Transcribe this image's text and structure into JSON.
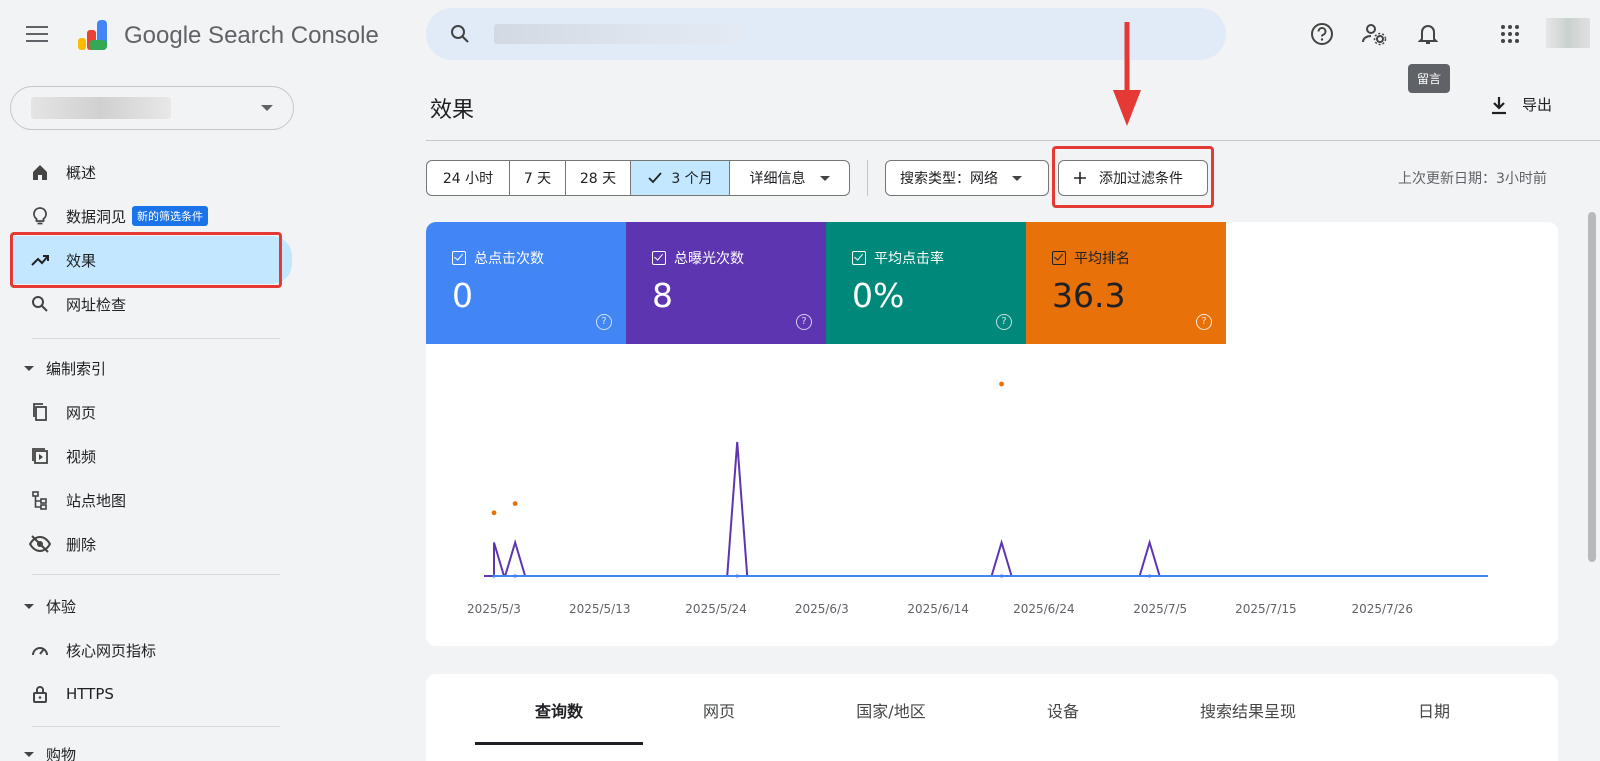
{
  "header": {
    "brand": "Google Search Console",
    "tooltip": "留言"
  },
  "sidebar": {
    "items": [
      {
        "label": "概述",
        "icon": "home-icon"
      },
      {
        "label": "数据洞见",
        "icon": "lightbulb-icon",
        "badge": "新的筛选条件"
      },
      {
        "label": "效果",
        "icon": "trending-up-icon",
        "active": true
      },
      {
        "label": "网址检查",
        "icon": "search-icon"
      }
    ],
    "section_index": {
      "title": "编制索引",
      "items": [
        {
          "label": "网页",
          "icon": "pages-icon"
        },
        {
          "label": "视频",
          "icon": "video-icon"
        },
        {
          "label": "站点地图",
          "icon": "sitemap-icon"
        },
        {
          "label": "删除",
          "icon": "visibility-off-icon"
        }
      ]
    },
    "section_experience": {
      "title": "体验",
      "items": [
        {
          "label": "核心网页指标",
          "icon": "speed-icon"
        },
        {
          "label": "HTTPS",
          "icon": "lock-icon"
        }
      ]
    },
    "section_shopping": {
      "title": "购物"
    }
  },
  "main": {
    "title": "效果",
    "export_label": "导出",
    "date_ranges": [
      "24 小时",
      "7 天",
      "28 天",
      "3 个月",
      "详细信息"
    ],
    "selected_range": "3 个月",
    "search_type": "搜索类型：网络",
    "add_filter": "添加过滤条件",
    "last_updated": "上次更新日期：3小时前",
    "metrics": [
      {
        "label": "总点击次数",
        "value": "0",
        "color": "#4285f4"
      },
      {
        "label": "总曝光次数",
        "value": "8",
        "color": "#5e35b1"
      },
      {
        "label": "平均点击率",
        "value": "0%",
        "color": "#00897b"
      },
      {
        "label": "平均排名",
        "value": "36.3",
        "color": "#e8710a"
      }
    ],
    "tabs": [
      "查询数",
      "网页",
      "国家/地区",
      "设备",
      "搜索结果呈现",
      "日期"
    ],
    "active_tab": "查询数"
  },
  "chart_data": {
    "type": "line",
    "x_tick_labels": [
      "2025/5/3",
      "2025/5/13",
      "2025/5/24",
      "2025/6/3",
      "2025/6/14",
      "2025/6/24",
      "2025/7/5",
      "2025/7/15",
      "2025/7/26"
    ],
    "series": [
      {
        "name": "总曝光次数",
        "color": "#5e35b1",
        "points": [
          [
            "2025/5/3",
            1
          ],
          [
            "2025/5/5",
            1
          ],
          [
            "2025/5/26",
            4
          ],
          [
            "2025/6/20",
            1
          ],
          [
            "2025/7/4",
            1
          ]
        ]
      },
      {
        "name": "总点击次数",
        "color": "#4285f4",
        "points": []
      },
      {
        "name": "平均排名",
        "color": "#e8710a",
        "points": [
          [
            "2025/5/3",
            43
          ],
          [
            "2025/5/5",
            41
          ],
          [
            "2025/6/20",
            15
          ]
        ]
      }
    ]
  }
}
